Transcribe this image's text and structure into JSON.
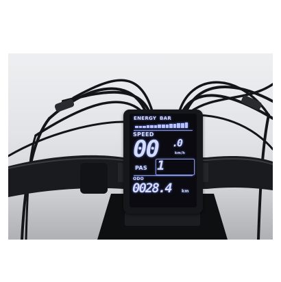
{
  "display": {
    "energy_label": "ENERGY",
    "bar_label": "BAR",
    "energy_level": 1.0,
    "speed_label": "SPEED",
    "speed_value": "00",
    "speed_decimal": ".0",
    "speed_unit": "km/h",
    "pas_label": "PAS",
    "pas_value": "1",
    "odo_label": "ODO",
    "odo_value": "0028.4",
    "odo_unit": "km"
  },
  "colors": {
    "lcd_glow": "#d4dcff",
    "screen_bg": "#0a0a10",
    "housing": "#16171b",
    "handlebar": "#1a1b1e",
    "background": "#e6e7ea"
  }
}
